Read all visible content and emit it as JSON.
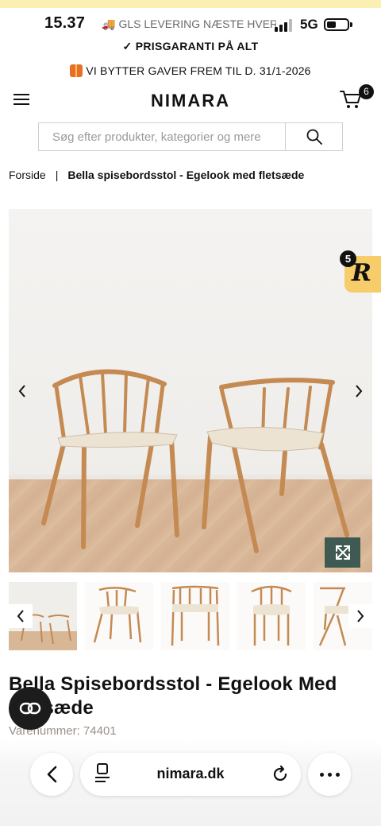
{
  "status_bar": {
    "time": "15.37",
    "banner": "GLS LEVERING NÆSTE HVERDAG",
    "network": "5G"
  },
  "promos": {
    "price_guarantee": "✓ PRISGARANTI PÅ ALT",
    "gift_exchange": "VI BYTTER GAVER FREM TIL D. 31/1-2026"
  },
  "header": {
    "logo": "NIMARA",
    "cart_count": "6"
  },
  "search": {
    "placeholder": "Søg efter produkter, kategorier og mere"
  },
  "breadcrumb": {
    "home": "Forside",
    "separator": "|",
    "current": "Bella spisebordsstol - Egelook med fletsæde"
  },
  "reviews_widget": {
    "count": "5",
    "letter": "R"
  },
  "product": {
    "title": "Bella Spisebordsstol - Egelook Med Fletsæde",
    "sku_label": "Varenummer: 74401"
  },
  "browser": {
    "url": "nimara.dk"
  },
  "colors": {
    "zoom_button": "#3f5a52",
    "reviews_tab": "#f7cc6a",
    "promo_strip": "#fbf0b3",
    "sku_text": "#9b8f8a"
  }
}
